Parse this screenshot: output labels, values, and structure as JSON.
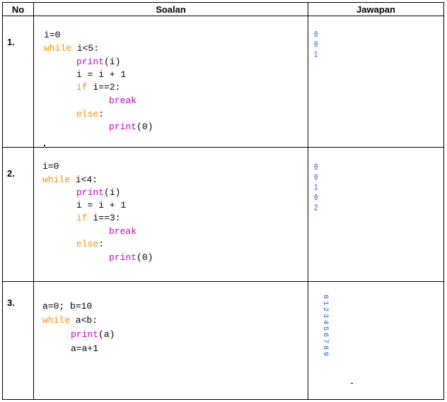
{
  "headers": {
    "no": "No",
    "soalan": "Soalan",
    "jawapan": "Jawapan"
  },
  "rows": [
    {
      "number": "1.",
      "code": {
        "l1": "i=0",
        "l2_kw": "while",
        "l2_rest": " i<5:",
        "l3_fn": "print",
        "l3_rest": "(i)",
        "l4": "i = i + 1",
        "l5_kw": "if",
        "l5_rest": " i==2:",
        "l6_kw": "break",
        "l7_kw": "else",
        "l7_rest": ":",
        "l8_fn": "print",
        "l8_rest": "(0)"
      },
      "answer": "0\n0\n1"
    },
    {
      "number": "2.",
      "code": {
        "l1": "i=0",
        "l2_kw": "while",
        "l2_rest": " i<4:",
        "l3_fn": "print",
        "l3_rest": "(i)",
        "l4": "i = i + 1",
        "l5_kw": "if",
        "l5_rest": " i==3:",
        "l6_kw": "break",
        "l7_kw": "else",
        "l7_rest": ":",
        "l8_fn": "print",
        "l8_rest": "(0)"
      },
      "answer": "0\n0\n1\n0\n2"
    },
    {
      "number": "3.",
      "code": {
        "l1": "a=0; b=10",
        "l2_kw": "while",
        "l2_rest": " a<b:",
        "l3_fn": "print",
        "l3_rest": "(a)",
        "l4": "a=a+1"
      },
      "answer": "0123456789"
    }
  ],
  "colors": {
    "keyword": "#ff8c00",
    "function": "#c000c0",
    "answer": "#1f4fd0"
  }
}
